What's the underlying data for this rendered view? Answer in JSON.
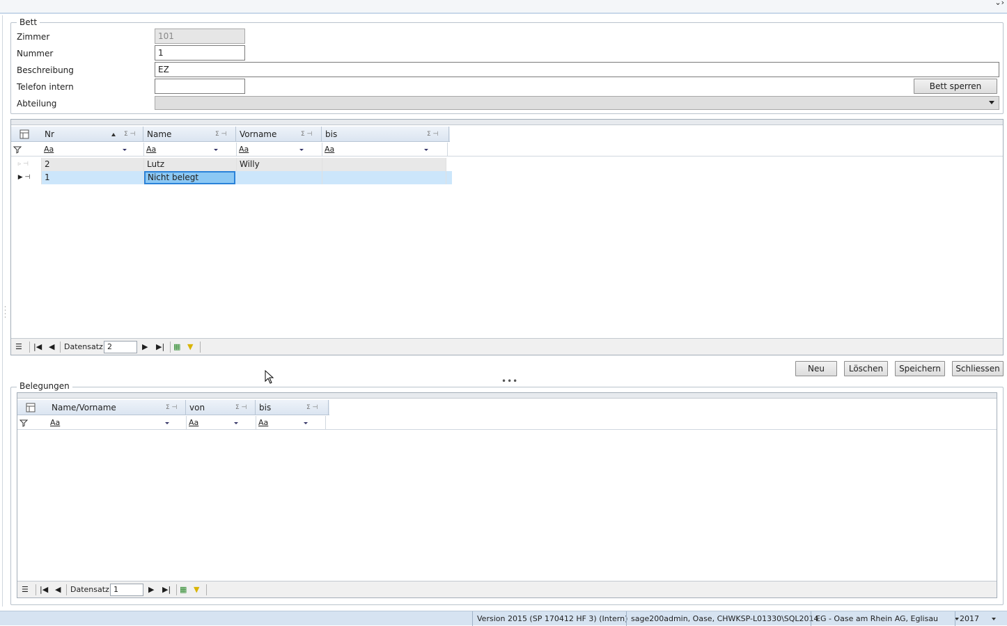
{
  "bett": {
    "legend": "Bett",
    "fields": {
      "zimmer": {
        "label": "Zimmer",
        "value": "101"
      },
      "nummer": {
        "label": "Nummer",
        "value": "1"
      },
      "beschreibung": {
        "label": "Beschreibung",
        "value": "EZ"
      },
      "telefon": {
        "label": "Telefon intern",
        "value": ""
      },
      "abteilung": {
        "label": "Abteilung",
        "value": ""
      }
    },
    "sperren_button": "Bett sperren"
  },
  "grid1": {
    "columns": [
      "Nr",
      "Name",
      "Vorname",
      "bis"
    ],
    "filter_placeholder": "Aa",
    "rows": [
      {
        "nr": "2",
        "name": "Lutz",
        "vorname": "Willy",
        "bis": ""
      },
      {
        "nr": "1",
        "name": "Nicht belegt",
        "vorname": "",
        "bis": ""
      }
    ],
    "nav": {
      "label": "Datensatz",
      "value": "2"
    }
  },
  "actions": {
    "neu": "Neu",
    "loeschen": "Löschen",
    "speichern": "Speichern",
    "schliessen": "Schliessen"
  },
  "belegungen": {
    "legend": "Belegungen",
    "columns": [
      "Name/Vorname",
      "von",
      "bis"
    ],
    "filter_placeholder": "Aa",
    "nav": {
      "label": "Datensatz",
      "value": "1"
    }
  },
  "status": {
    "version": "Version 2015 (SP 170412 HF 3) (Intern)",
    "connection": "sage200admin, Oase, CHWKSP-L01330\\SQL2014",
    "company": "EG - Oase am Rhein AG, Eglisau",
    "year": "2017"
  },
  "icons": {
    "sigma": "Σ",
    "pin": "⊣",
    "sort": "sort-ascending-icon"
  }
}
